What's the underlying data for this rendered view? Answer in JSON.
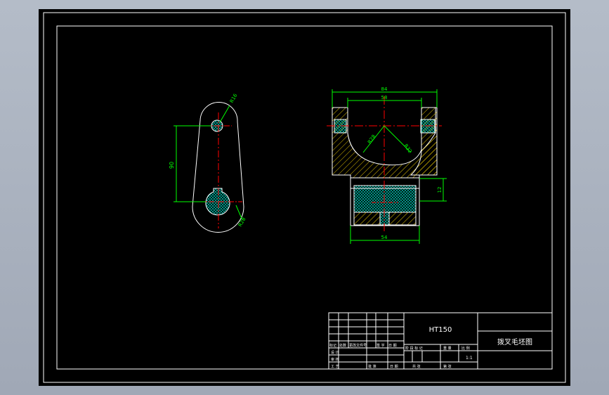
{
  "drawing": {
    "background_color": "#000000",
    "frame_color": "#ffffff",
    "outline_color": "#ffffff",
    "dimension_color": "#00ff00",
    "centerline_color": "#ff0000",
    "hatch_color": "#e5c400"
  },
  "front_view": {
    "top_hole_radius_label": "R16",
    "bottom_radius_label": "R28",
    "center_distance_label": "90"
  },
  "section_view": {
    "overall_width_label": "84",
    "inner_width_label": "58",
    "left_arc_label": "R28",
    "right_arc_label": "R32",
    "bore_height_label": "12",
    "hub_width_label": "54"
  },
  "title_block": {
    "material": "HT150",
    "drawing_name": "拨叉毛坯图",
    "scale": "1:1",
    "rev_headers": [
      "标记",
      "处数",
      "更改文件号",
      "签 字",
      "日 期"
    ],
    "design_label": "设 计",
    "check_label": "审 核",
    "process_label": "工 艺",
    "approve_label": "批 准",
    "date_label": "日 期",
    "stage_label": "阶 段 标 记",
    "weight_label": "重 量",
    "scale_label": "比 例",
    "sheet_total_label": "共 张",
    "sheet_no_label": "第 张"
  }
}
